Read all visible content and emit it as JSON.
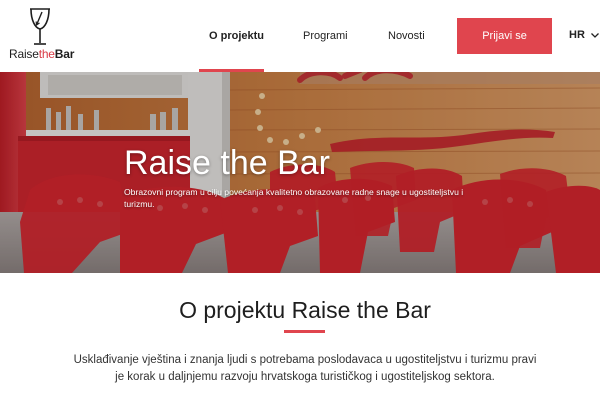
{
  "brand": {
    "raise": "Raise",
    "the": "the",
    "bar": "Bar",
    "logo_icon": "cocktail-glass-icon"
  },
  "nav": {
    "items": [
      {
        "label": "O projektu",
        "active": true
      },
      {
        "label": "Programi",
        "active": false
      },
      {
        "label": "Novosti",
        "active": false
      }
    ],
    "cta_label": "Prijavi se",
    "language": "HR",
    "language_icon": "chevron-down-icon"
  },
  "hero": {
    "title": "Raise the Bar",
    "subtitle": "Obrazovni program u cilju povećanja kvalitetno obrazovane radne snage u ugostiteljstvu i turizmu."
  },
  "about": {
    "title": "O projektu Raise the Bar",
    "lead": "Usklađivanje vještina i znanja ljudi s potrebama poslodavaca u ugostiteljstvu i turizmu pravi je korak u daljnjemu razvoju hrvatskoga turističkog i ugostiteljskog sektora."
  },
  "colors": {
    "accent": "#e0454e",
    "text": "#1e1e1e",
    "hero_wall": "#c8763c",
    "chairs": "#d8262f"
  }
}
